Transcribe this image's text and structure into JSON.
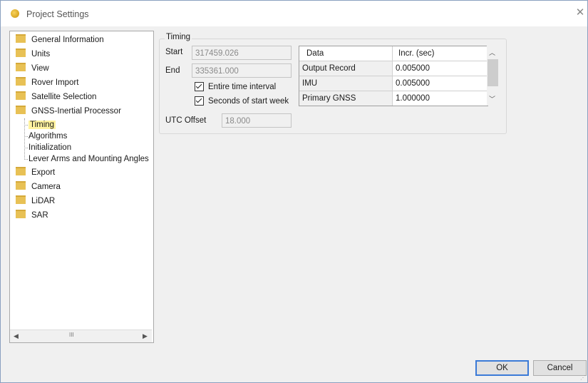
{
  "window": {
    "title": "Project Settings",
    "close_glyph": "✕"
  },
  "tree": {
    "top_items": [
      {
        "label": "General Information",
        "icon": "folder-icon"
      },
      {
        "label": "Units",
        "icon": "folder-icon"
      },
      {
        "label": "View",
        "icon": "folder-icon"
      },
      {
        "label": "Rover Import",
        "icon": "folder-icon"
      },
      {
        "label": "Satellite Selection",
        "icon": "folder-icon"
      },
      {
        "label": "GNSS-Inertial Processor",
        "icon": "folder-icon"
      }
    ],
    "sub_items": [
      {
        "label": "Timing",
        "selected": true
      },
      {
        "label": "Algorithms"
      },
      {
        "label": "Initialization"
      },
      {
        "label": "Lever Arms and Mounting Angles"
      }
    ],
    "bottom_items": [
      {
        "label": "Export",
        "icon": "folder-icon"
      },
      {
        "label": "Camera",
        "icon": "folder-icon"
      },
      {
        "label": "LiDAR",
        "icon": "folder-icon"
      },
      {
        "label": "SAR",
        "icon": "folder-icon"
      }
    ],
    "scroll_left": "◀",
    "scroll_right": "▶",
    "scroll_grip": "III",
    "selected_color": "#fff3a0"
  },
  "timing": {
    "group_label": "Timing",
    "start_label": "Start",
    "start_value": "317459.026",
    "end_label": "End",
    "end_value": "335361.000",
    "entire_interval_label": "Entire time interval",
    "entire_interval_checked": true,
    "seconds_week_label": "Seconds of start week",
    "seconds_week_checked": true,
    "utc_label": "UTC Offset",
    "utc_value": "18.000"
  },
  "data_grid": {
    "headers": [
      "Data",
      "Incr. (sec)"
    ],
    "rows": [
      [
        "Output Record",
        "0.005000"
      ],
      [
        "IMU",
        "0.005000"
      ],
      [
        "Primary GNSS",
        "1.000000"
      ]
    ],
    "scroll_up": "︿",
    "scroll_down": "﹀"
  },
  "buttons": {
    "ok": "OK",
    "cancel": "Cancel"
  },
  "colors": {
    "accent": "#3b7ad7",
    "folder": "#e8c155"
  }
}
